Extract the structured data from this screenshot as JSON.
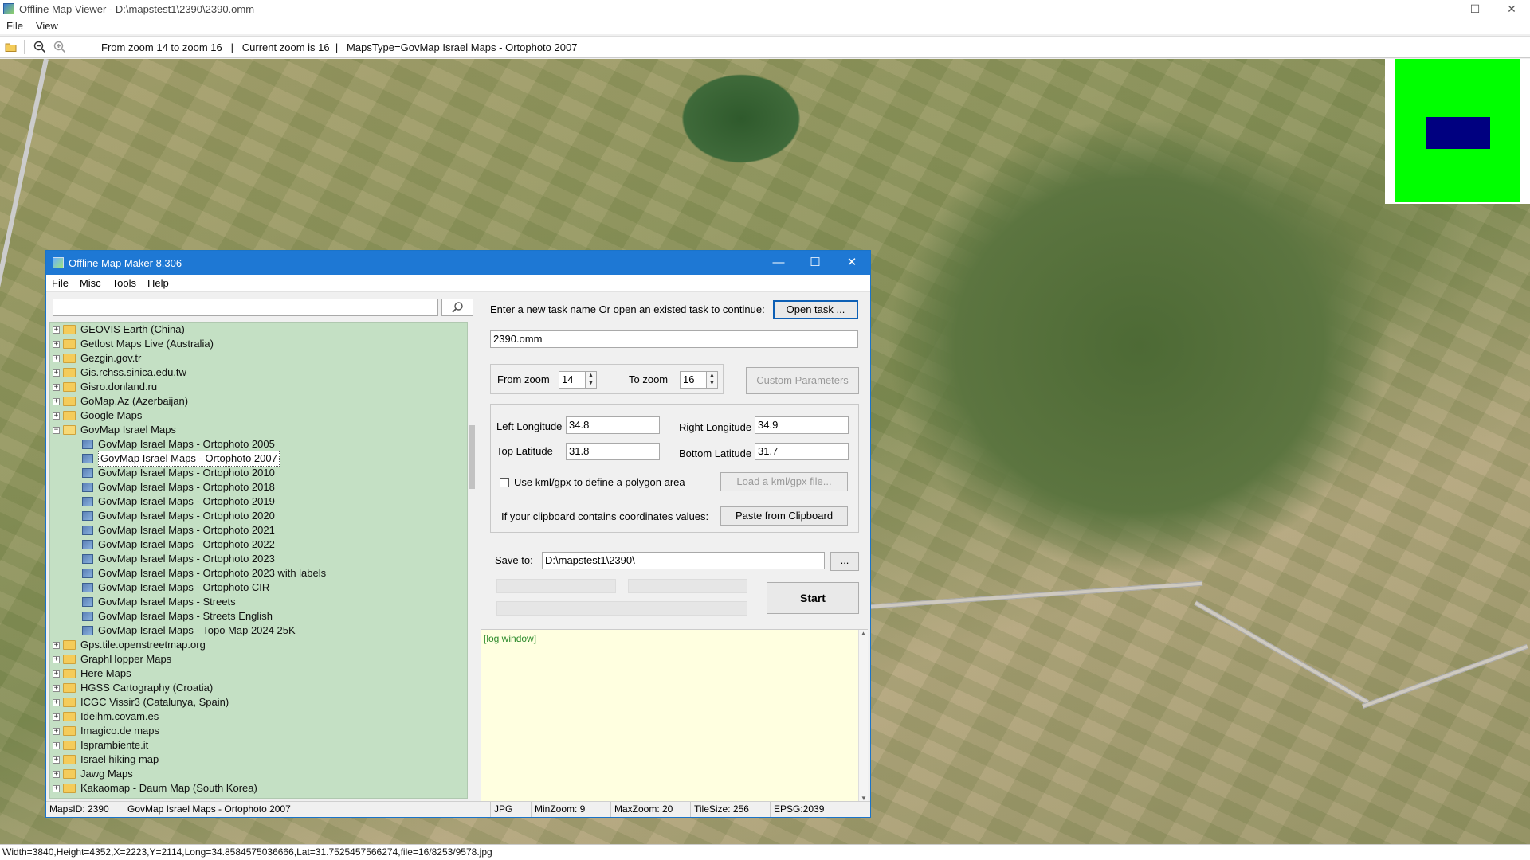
{
  "window": {
    "title": "Offline Map Viewer - D:\\mapstest1\\2390\\2390.omm",
    "controls": {
      "minimize": "—",
      "maximize": "☐",
      "close": "✕"
    }
  },
  "menu": [
    "File",
    "View"
  ],
  "toolbar": {
    "open_icon": "folder-open-icon",
    "zoom_out_icon": "zoom-out-icon",
    "zoom_in_icon": "zoom-in-icon",
    "info": "From zoom 14 to zoom 16   |   Current zoom is 16  |   MapsType=GovMap Israel Maps - Ortophoto 2007"
  },
  "statusbar": "Width=3840,Height=4352,X=2223,Y=2114,Long=34.8584575036666,Lat=31.7525457566274,file=16/8253/9578.jpg",
  "dialog": {
    "title": "Offline Map Maker 8.306",
    "controls": {
      "minimize": "—",
      "maximize": "☐",
      "close": "✕"
    },
    "menu": [
      "File",
      "Misc",
      "Tools",
      "Help"
    ],
    "search": {
      "value": "",
      "placeholder": "",
      "icon": "search-icon"
    },
    "tree": [
      {
        "label": "GEOVIS Earth (China)",
        "expanded": false
      },
      {
        "label": "Getlost Maps Live (Australia)",
        "expanded": false
      },
      {
        "label": "Gezgin.gov.tr",
        "expanded": false
      },
      {
        "label": "Gis.rchss.sinica.edu.tw",
        "expanded": false
      },
      {
        "label": "Gisro.donland.ru",
        "expanded": false
      },
      {
        "label": "GoMap.Az (Azerbaijan)",
        "expanded": false
      },
      {
        "label": "Google Maps",
        "expanded": false
      },
      {
        "label": "GovMap Israel Maps",
        "expanded": true,
        "children": [
          {
            "label": "GovMap Israel Maps - Ortophoto 2005"
          },
          {
            "label": "GovMap Israel Maps - Ortophoto 2007",
            "selected": true
          },
          {
            "label": "GovMap Israel Maps - Ortophoto 2010"
          },
          {
            "label": "GovMap Israel Maps - Ortophoto 2018"
          },
          {
            "label": "GovMap Israel Maps - Ortophoto 2019"
          },
          {
            "label": "GovMap Israel Maps - Ortophoto 2020"
          },
          {
            "label": "GovMap Israel Maps - Ortophoto 2021"
          },
          {
            "label": "GovMap Israel Maps - Ortophoto 2022"
          },
          {
            "label": "GovMap Israel Maps - Ortophoto 2023"
          },
          {
            "label": "GovMap Israel Maps - Ortophoto 2023 with labels"
          },
          {
            "label": "GovMap Israel Maps - Ortophoto CIR"
          },
          {
            "label": "GovMap Israel Maps - Streets"
          },
          {
            "label": "GovMap Israel Maps - Streets English"
          },
          {
            "label": "GovMap Israel Maps - Topo Map 2024 25K"
          }
        ]
      },
      {
        "label": "Gps.tile.openstreetmap.org",
        "expanded": false
      },
      {
        "label": "GraphHopper Maps",
        "expanded": false
      },
      {
        "label": "Here Maps",
        "expanded": false
      },
      {
        "label": "HGSS Cartography (Croatia)",
        "expanded": false
      },
      {
        "label": "ICGC Vissir3 (Catalunya, Spain)",
        "expanded": false
      },
      {
        "label": "Ideihm.covam.es",
        "expanded": false
      },
      {
        "label": "Imagico.de maps",
        "expanded": false
      },
      {
        "label": "Isprambiente.it",
        "expanded": false
      },
      {
        "label": "Israel hiking map",
        "expanded": false
      },
      {
        "label": "Jawg Maps",
        "expanded": false
      },
      {
        "label": "Kakaomap - Daum Map (South Korea)",
        "expanded": false
      }
    ],
    "task_prompt": "Enter a new task name Or open an existed task to continue:",
    "open_task_button": "Open task ...",
    "task_name": "2390.omm",
    "from_zoom_label": "From zoom",
    "from_zoom": "14",
    "to_zoom_label": "To zoom",
    "to_zoom": "16",
    "custom_params_button": "Custom Parameters",
    "left_lon_label": "Left Longitude",
    "left_lon": "34.8",
    "right_lon_label": "Right Longitude",
    "right_lon": "34.9",
    "top_lat_label": "Top Latitude",
    "top_lat": "31.8",
    "bottom_lat_label": "Bottom Latitude",
    "bottom_lat": "31.7",
    "kml_checkbox_label": "Use kml/gpx to define a polygon area",
    "kml_button": "Load a kml/gpx file...",
    "clipboard_label": "If your clipboard contains coordinates values:",
    "clipboard_button": "Paste from Clipboard",
    "save_to_label": "Save to:",
    "save_to": "D:\\mapstest1\\2390\\",
    "browse_button": "...",
    "start_button": "Start",
    "log_text": "[log window]",
    "status": {
      "maps_id": "MapsID: 2390",
      "map_name": "GovMap Israel Maps - Ortophoto 2007",
      "format": "JPG",
      "min_zoom": "MinZoom: 9",
      "max_zoom": "MaxZoom: 20",
      "tile_size": "TileSize: 256",
      "epsg": "EPSG:2039"
    }
  },
  "colors": {
    "accent": "#1e78d4",
    "tree_bg": "#c4e0c4",
    "log_bg": "#ffffe0",
    "minimap_green": "#00ff00",
    "minimap_view": "#000080"
  }
}
